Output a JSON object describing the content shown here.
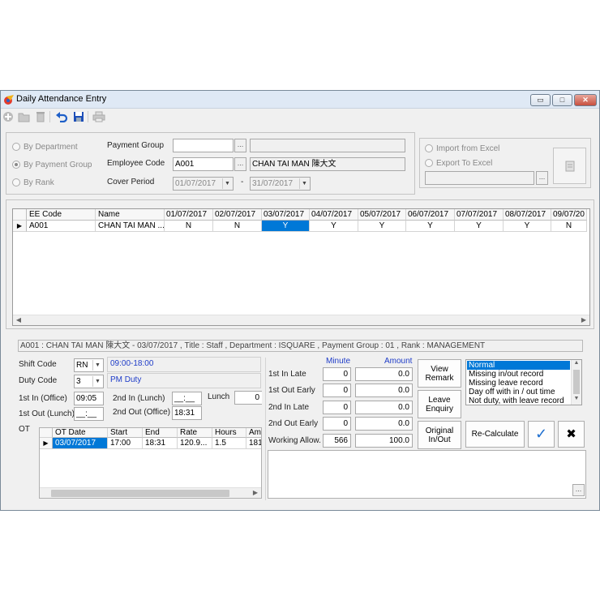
{
  "window": {
    "title": "Daily Attendance Entry",
    "controls": {
      "minimize": "▭",
      "maximize": "□",
      "close": "✕"
    }
  },
  "toolbar": {
    "icons": [
      "add-icon",
      "open-folder-icon",
      "delete-icon",
      "undo-icon",
      "save-icon",
      "print-icon"
    ]
  },
  "filters": {
    "by_department": "By Department",
    "by_payment_group": "By Payment Group",
    "by_rank": "By Rank",
    "payment_group_label": "Payment Group",
    "payment_group_value": "",
    "payment_group_desc": "",
    "employee_code_label": "Employee Code",
    "employee_code_value": "A001",
    "employee_name": "CHAN TAI MAN  陳大文",
    "cover_period_label": "Cover Period",
    "period_from": "01/07/2017",
    "period_sep": "-",
    "period_to": "31/07/2017",
    "lookup_btn": "..."
  },
  "import_export": {
    "import_label": "Import from Excel",
    "export_label": "Export To Excel",
    "file_path": "",
    "browse": "..."
  },
  "attendance_grid": {
    "columns": [
      "EE Code",
      "Name",
      "01/07/2017",
      "02/07/2017",
      "03/07/2017",
      "04/07/2017",
      "05/07/2017",
      "06/07/2017",
      "07/07/2017",
      "08/07/2017",
      "09/07/20"
    ],
    "row": [
      "A001",
      "CHAN TAI MAN  ...",
      "N",
      "N",
      "Y",
      "Y",
      "Y",
      "Y",
      "Y",
      "Y",
      "N"
    ],
    "selected_col": 4
  },
  "info_bar": "A001 : CHAN TAI MAN  陳大文  - 03/07/2017 , Title : Staff , Department : ISQUARE , Payment Group : 01 , Rank : MANAGEMENT",
  "shift": {
    "shift_code_label": "Shift Code",
    "shift_code": "RN",
    "shift_time": "09:00-18:00",
    "duty_code_label": "Duty Code",
    "duty_code": "3",
    "duty_desc": "PM Duty",
    "in_office_label": "1st In (Office)",
    "in_office": "09:05",
    "in_lunch_label": "2nd In (Lunch)",
    "in_lunch": "__:__",
    "lunch_label": "Lunch",
    "lunch_value": "0",
    "out_lunch_label": "1st Out (Lunch)",
    "out_lunch": "__:__",
    "out_office_label": "2nd Out (Office)",
    "out_office": "18:31"
  },
  "ot": {
    "label": "OT",
    "columns": [
      "OT Date",
      "Start",
      "End",
      "Rate",
      "Hours",
      "Am"
    ],
    "row": [
      "03/07/2017",
      "17:00",
      "18:31",
      "120.9...",
      "1.5",
      "181"
    ]
  },
  "summary": {
    "minute_header": "Minute",
    "amount_header": "Amount",
    "rows": [
      {
        "label": "1st In Late",
        "minute": "0",
        "amount": "0.0"
      },
      {
        "label": "1st Out Early",
        "minute": "0",
        "amount": "0.0"
      },
      {
        "label": "2nd In Late",
        "minute": "0",
        "amount": "0.0"
      },
      {
        "label": "2nd Out Early",
        "minute": "0",
        "amount": "0.0"
      },
      {
        "label": "Working Allow.",
        "minute": "566",
        "amount": "100.0"
      }
    ]
  },
  "actions": {
    "view_remark": "View\nRemark",
    "leave_enquiry": "Leave\nEnquiry",
    "original_inout": "Original\nIn/Out",
    "recalculate": "Re-Calculate",
    "confirm_icon": "✓",
    "cancel_icon": "✖"
  },
  "status_list": {
    "items": [
      "Normal",
      "Missing in/out record",
      "Missing leave record",
      "Day off with in / out time",
      "Not duty, with leave record"
    ],
    "selected": 0
  },
  "remark_box": {
    "value": "",
    "browse": "..."
  },
  "colors": {
    "accent": "#0078d7",
    "blue_text": "#1e3cc8",
    "confirm": "#1e6fd0"
  }
}
